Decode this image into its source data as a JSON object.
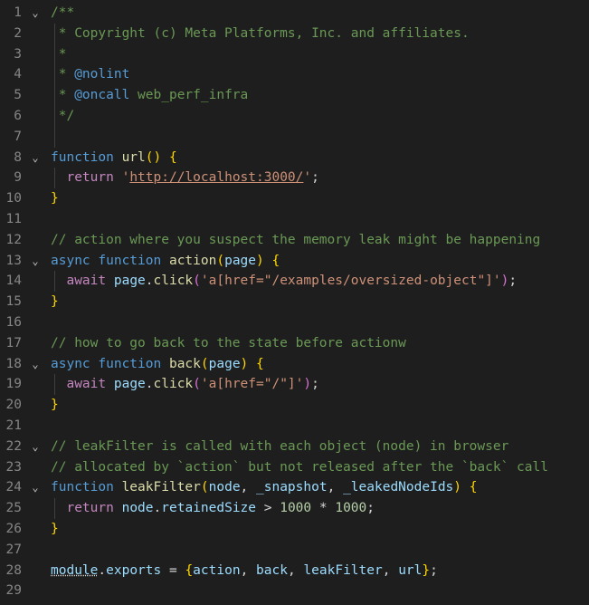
{
  "editor": {
    "lines": [
      {
        "num": "1",
        "fold": "⌄",
        "tokens": [
          {
            "t": "/**",
            "c": "comment"
          }
        ]
      },
      {
        "num": "2",
        "fold": "",
        "tokens": [
          {
            "t": " * Copyright (c) Meta Platforms, Inc. and affiliates.",
            "c": "comment"
          }
        ]
      },
      {
        "num": "3",
        "fold": "",
        "tokens": [
          {
            "t": " *",
            "c": "comment"
          }
        ]
      },
      {
        "num": "4",
        "fold": "",
        "tokens": [
          {
            "t": " * ",
            "c": "comment"
          },
          {
            "t": "@nolint",
            "c": "doctag"
          }
        ]
      },
      {
        "num": "5",
        "fold": "",
        "tokens": [
          {
            "t": " * ",
            "c": "comment"
          },
          {
            "t": "@oncall",
            "c": "doctag"
          },
          {
            "t": " web_perf_infra",
            "c": "comment"
          }
        ]
      },
      {
        "num": "6",
        "fold": "",
        "tokens": [
          {
            "t": " */",
            "c": "comment"
          }
        ]
      },
      {
        "num": "7",
        "fold": "",
        "tokens": []
      },
      {
        "num": "8",
        "fold": "⌄",
        "tokens": [
          {
            "t": "function",
            "c": "keyword"
          },
          {
            "t": " ",
            "c": "punc"
          },
          {
            "t": "url",
            "c": "func"
          },
          {
            "t": "()",
            "c": "brace1"
          },
          {
            "t": " ",
            "c": "punc"
          },
          {
            "t": "{",
            "c": "brace1"
          }
        ]
      },
      {
        "num": "9",
        "fold": "",
        "tokens": [
          {
            "t": "  ",
            "c": "punc"
          },
          {
            "t": "return",
            "c": "control"
          },
          {
            "t": " '",
            "c": "str"
          },
          {
            "t": "http://localhost:3000/",
            "c": "str url"
          },
          {
            "t": "'",
            "c": "str"
          },
          {
            "t": ";",
            "c": "punc"
          }
        ]
      },
      {
        "num": "10",
        "fold": "",
        "tokens": [
          {
            "t": "}",
            "c": "brace1"
          }
        ]
      },
      {
        "num": "11",
        "fold": "",
        "tokens": []
      },
      {
        "num": "12",
        "fold": "",
        "tokens": [
          {
            "t": "// action where you suspect the memory leak might be happening",
            "c": "comment"
          }
        ]
      },
      {
        "num": "13",
        "fold": "⌄",
        "tokens": [
          {
            "t": "async",
            "c": "keyword"
          },
          {
            "t": " ",
            "c": "punc"
          },
          {
            "t": "function",
            "c": "keyword"
          },
          {
            "t": " ",
            "c": "punc"
          },
          {
            "t": "action",
            "c": "func"
          },
          {
            "t": "(",
            "c": "brace1"
          },
          {
            "t": "page",
            "c": "param"
          },
          {
            "t": ")",
            "c": "brace1"
          },
          {
            "t": " ",
            "c": "punc"
          },
          {
            "t": "{",
            "c": "brace1"
          }
        ]
      },
      {
        "num": "14",
        "fold": "",
        "tokens": [
          {
            "t": "  ",
            "c": "punc"
          },
          {
            "t": "await",
            "c": "control"
          },
          {
            "t": " ",
            "c": "punc"
          },
          {
            "t": "page",
            "c": "var"
          },
          {
            "t": ".",
            "c": "punc"
          },
          {
            "t": "click",
            "c": "func"
          },
          {
            "t": "(",
            "c": "brace2"
          },
          {
            "t": "'a[href=\"/examples/oversized-object\"]'",
            "c": "str"
          },
          {
            "t": ")",
            "c": "brace2"
          },
          {
            "t": ";",
            "c": "punc"
          }
        ]
      },
      {
        "num": "15",
        "fold": "",
        "tokens": [
          {
            "t": "}",
            "c": "brace1"
          }
        ]
      },
      {
        "num": "16",
        "fold": "",
        "tokens": []
      },
      {
        "num": "17",
        "fold": "",
        "tokens": [
          {
            "t": "// how to go back to the state before actionw",
            "c": "comment"
          }
        ]
      },
      {
        "num": "18",
        "fold": "⌄",
        "tokens": [
          {
            "t": "async",
            "c": "keyword"
          },
          {
            "t": " ",
            "c": "punc"
          },
          {
            "t": "function",
            "c": "keyword"
          },
          {
            "t": " ",
            "c": "punc"
          },
          {
            "t": "back",
            "c": "func"
          },
          {
            "t": "(",
            "c": "brace1"
          },
          {
            "t": "page",
            "c": "param"
          },
          {
            "t": ")",
            "c": "brace1"
          },
          {
            "t": " ",
            "c": "punc"
          },
          {
            "t": "{",
            "c": "brace1"
          }
        ]
      },
      {
        "num": "19",
        "fold": "",
        "tokens": [
          {
            "t": "  ",
            "c": "punc"
          },
          {
            "t": "await",
            "c": "control"
          },
          {
            "t": " ",
            "c": "punc"
          },
          {
            "t": "page",
            "c": "var"
          },
          {
            "t": ".",
            "c": "punc"
          },
          {
            "t": "click",
            "c": "func"
          },
          {
            "t": "(",
            "c": "brace2"
          },
          {
            "t": "'a[href=\"/\"]'",
            "c": "str"
          },
          {
            "t": ")",
            "c": "brace2"
          },
          {
            "t": ";",
            "c": "punc"
          }
        ]
      },
      {
        "num": "20",
        "fold": "",
        "tokens": [
          {
            "t": "}",
            "c": "brace1"
          }
        ]
      },
      {
        "num": "21",
        "fold": "",
        "tokens": []
      },
      {
        "num": "22",
        "fold": "⌄",
        "tokens": [
          {
            "t": "// leakFilter is called with each object (node) in browser",
            "c": "comment"
          }
        ]
      },
      {
        "num": "23",
        "fold": "",
        "tokens": [
          {
            "t": "// allocated by `action` but not released after the `back` call",
            "c": "comment"
          }
        ]
      },
      {
        "num": "24",
        "fold": "⌄",
        "tokens": [
          {
            "t": "function",
            "c": "keyword"
          },
          {
            "t": " ",
            "c": "punc"
          },
          {
            "t": "leakFilter",
            "c": "func"
          },
          {
            "t": "(",
            "c": "brace1"
          },
          {
            "t": "node",
            "c": "param"
          },
          {
            "t": ", ",
            "c": "punc"
          },
          {
            "t": "_snapshot",
            "c": "param"
          },
          {
            "t": ", ",
            "c": "punc"
          },
          {
            "t": "_leakedNodeIds",
            "c": "param"
          },
          {
            "t": ")",
            "c": "brace1"
          },
          {
            "t": " ",
            "c": "punc"
          },
          {
            "t": "{",
            "c": "brace1"
          }
        ]
      },
      {
        "num": "25",
        "fold": "",
        "tokens": [
          {
            "t": "  ",
            "c": "punc"
          },
          {
            "t": "return",
            "c": "control"
          },
          {
            "t": " ",
            "c": "punc"
          },
          {
            "t": "node",
            "c": "var"
          },
          {
            "t": ".",
            "c": "punc"
          },
          {
            "t": "retainedSize",
            "c": "var"
          },
          {
            "t": " > ",
            "c": "punc"
          },
          {
            "t": "1000",
            "c": "num"
          },
          {
            "t": " * ",
            "c": "punc"
          },
          {
            "t": "1000",
            "c": "num"
          },
          {
            "t": ";",
            "c": "punc"
          }
        ]
      },
      {
        "num": "26",
        "fold": "",
        "tokens": [
          {
            "t": "}",
            "c": "brace1"
          }
        ]
      },
      {
        "num": "27",
        "fold": "",
        "tokens": []
      },
      {
        "num": "28",
        "fold": "",
        "tokens": [
          {
            "t": "module",
            "c": "module dotted"
          },
          {
            "t": ".",
            "c": "punc"
          },
          {
            "t": "exports",
            "c": "var"
          },
          {
            "t": " = ",
            "c": "punc"
          },
          {
            "t": "{",
            "c": "brace1"
          },
          {
            "t": "action",
            "c": "var"
          },
          {
            "t": ", ",
            "c": "punc"
          },
          {
            "t": "back",
            "c": "var"
          },
          {
            "t": ", ",
            "c": "punc"
          },
          {
            "t": "leakFilter",
            "c": "var"
          },
          {
            "t": ", ",
            "c": "punc"
          },
          {
            "t": "url",
            "c": "var"
          },
          {
            "t": "}",
            "c": "brace1"
          },
          {
            "t": ";",
            "c": "punc"
          }
        ]
      },
      {
        "num": "29",
        "fold": "",
        "tokens": []
      }
    ]
  }
}
